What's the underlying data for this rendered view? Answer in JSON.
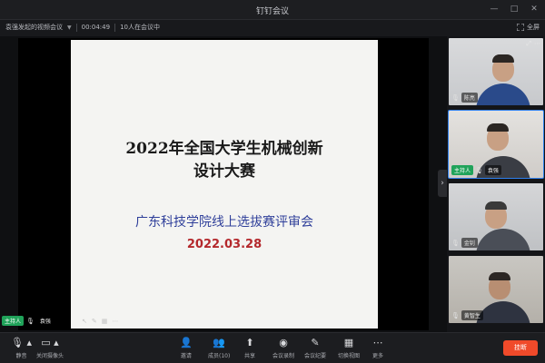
{
  "window": {
    "title": "钉钉会议",
    "controls": [
      "—",
      "□",
      "✕"
    ]
  },
  "infobar": {
    "meeting_name": "袁强发起的视频会议",
    "duration": "00:04:49",
    "participants": "10人在会议中",
    "fullscreen_label": "全屏"
  },
  "slide": {
    "title_line1": "2022年全国大学生机械创新",
    "title_line2": "设计大赛",
    "subtitle": "广东科技学院线上选拔赛评审会",
    "date": "2022.03.28"
  },
  "host": {
    "badge": "主持人",
    "name": "袁强"
  },
  "tiles": [
    {
      "name": "陈亮",
      "badge": ""
    },
    {
      "name": "袁强",
      "badge": "主持人"
    },
    {
      "name": "金钊",
      "badge": ""
    },
    {
      "name": "黄智生",
      "badge": ""
    }
  ],
  "toolbar": {
    "mute": "静音",
    "camera": "关闭摄像头",
    "invite": "邀请",
    "members": "成员(10)",
    "share": "共享",
    "record": "会议录制",
    "minutes": "会议纪要",
    "layout": "切换视图",
    "more": "更多",
    "end": "挂断"
  },
  "colors": {
    "accent": "#2f80ed",
    "end_button": "#f04a2a",
    "host_badge": "#20a35a",
    "slide_subtitle": "#2f3f9a",
    "slide_date": "#b4282c"
  }
}
